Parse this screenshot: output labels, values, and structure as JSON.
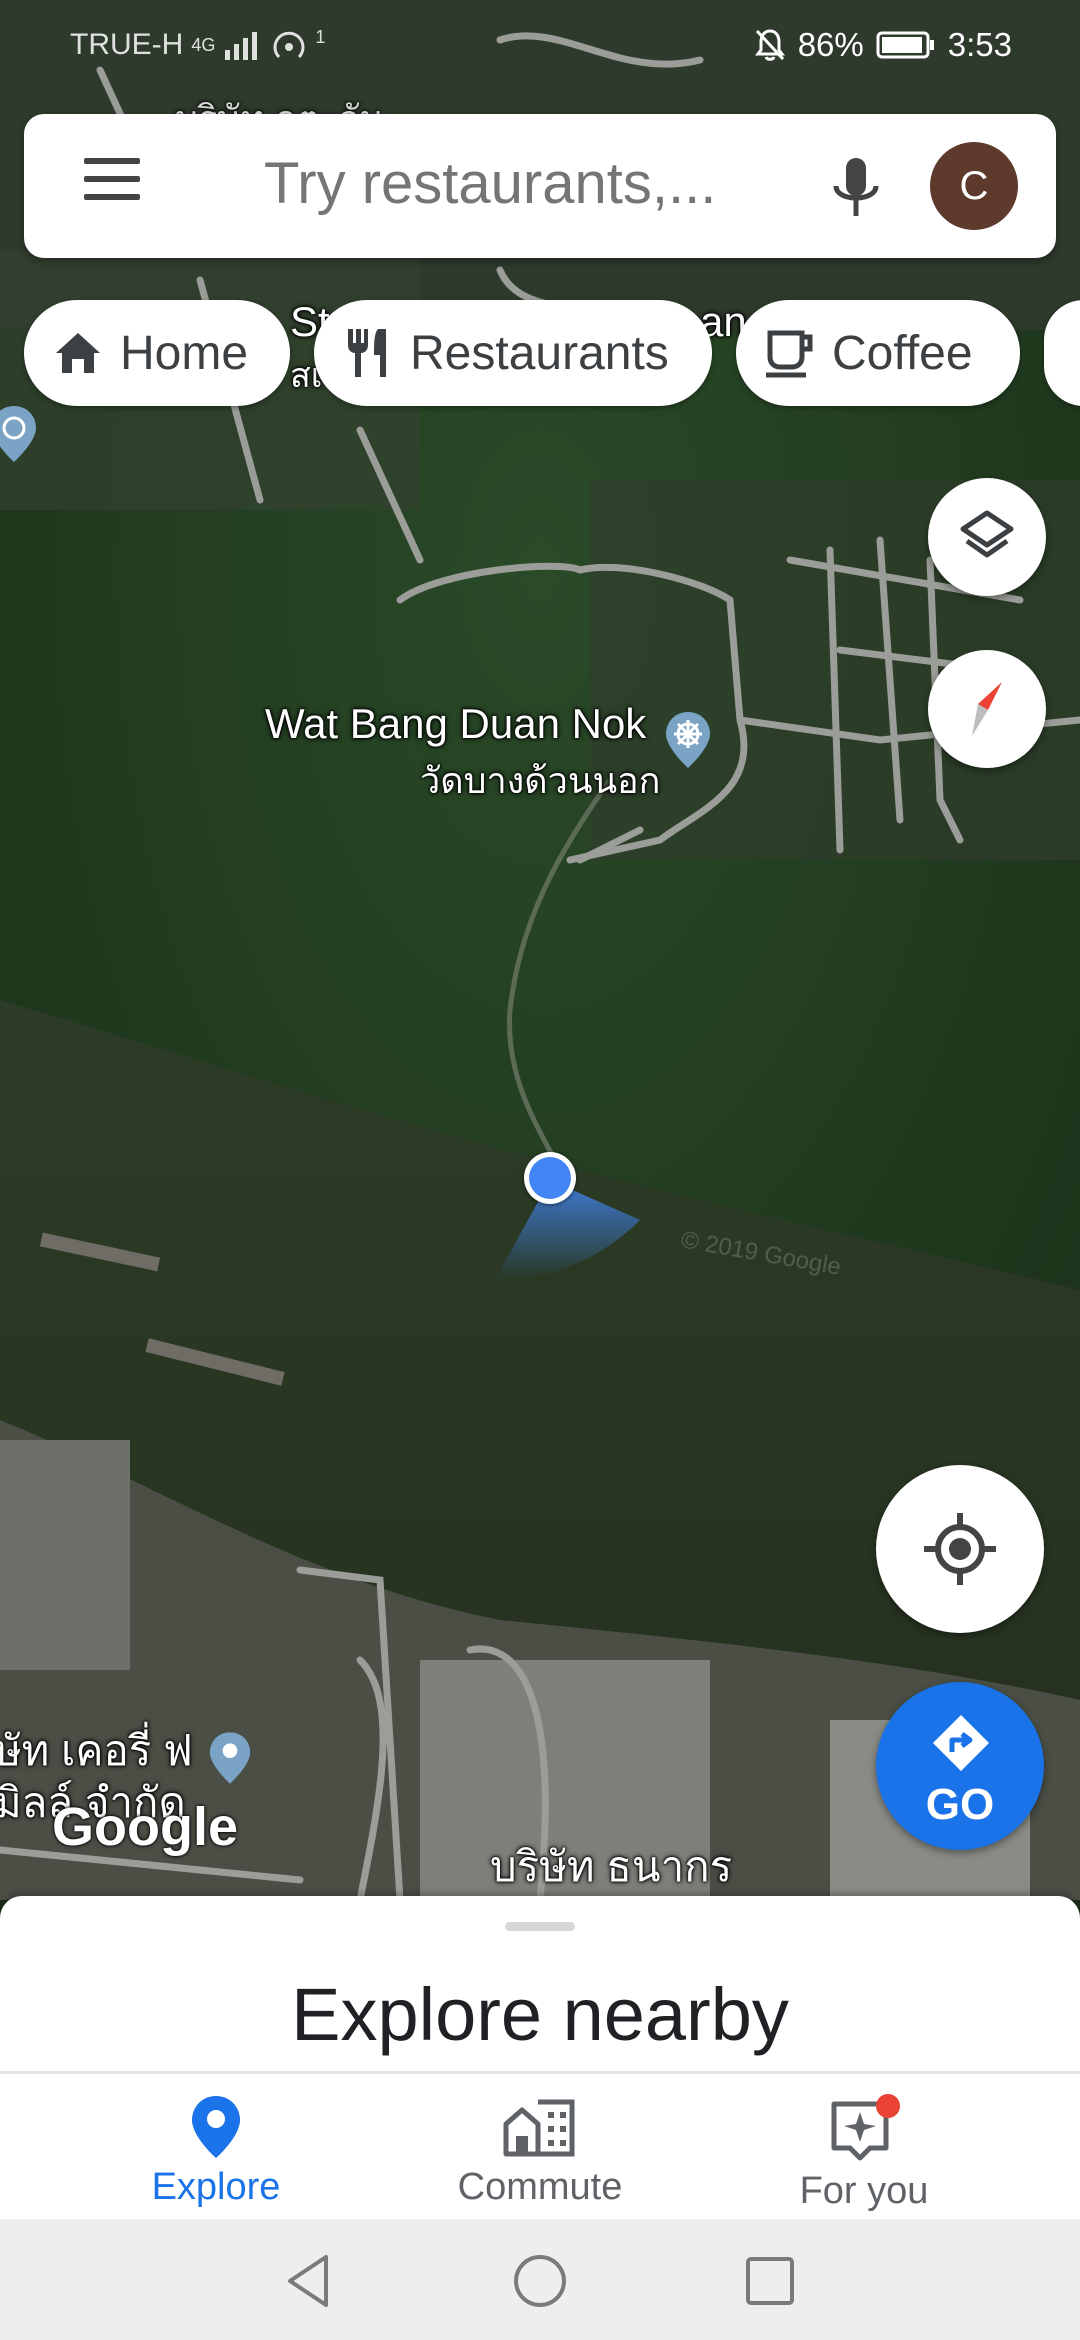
{
  "status_bar": {
    "carrier": "TRUE-H",
    "network": "4G",
    "hotspot_count": "1",
    "battery": "86%",
    "time": "3:53"
  },
  "search": {
    "placeholder": "Try restaurants,...",
    "avatar_letter": "C"
  },
  "chips": [
    {
      "label": "Home",
      "icon": "home-icon"
    },
    {
      "label": "Restaurants",
      "icon": "fork-knife-icon"
    },
    {
      "label": "Coffee",
      "icon": "coffee-cup-icon"
    }
  ],
  "map": {
    "labels": {
      "wat_en": "Wat Bang Duan Nok",
      "wat_th": "วัดบางด้วนนอก",
      "company_top": "บริษัท ฤตะวัน",
      "st_fragment": "St",
      "st_fragment2": "สเ",
      "an_fragment": "an",
      "company_left_1": "ษัท เคอรี่ ฟ",
      "company_left_2": "มิลล์ จำกัด",
      "company_bottom": "บริษัท ธนากร",
      "watermark": "© 2019 Google"
    },
    "google_logo": "Google",
    "go_label": "GO"
  },
  "sheet": {
    "title": "Explore nearby"
  },
  "bottom_nav": [
    {
      "label": "Explore",
      "icon": "explore-pin-icon",
      "active": true
    },
    {
      "label": "Commute",
      "icon": "commute-building-icon",
      "active": false
    },
    {
      "label": "For you",
      "icon": "for-you-sparkle-icon",
      "active": false
    }
  ],
  "colors": {
    "accent_blue": "#1a73e8",
    "location_dot": "#4285f4",
    "notification_red": "#ea4335"
  }
}
